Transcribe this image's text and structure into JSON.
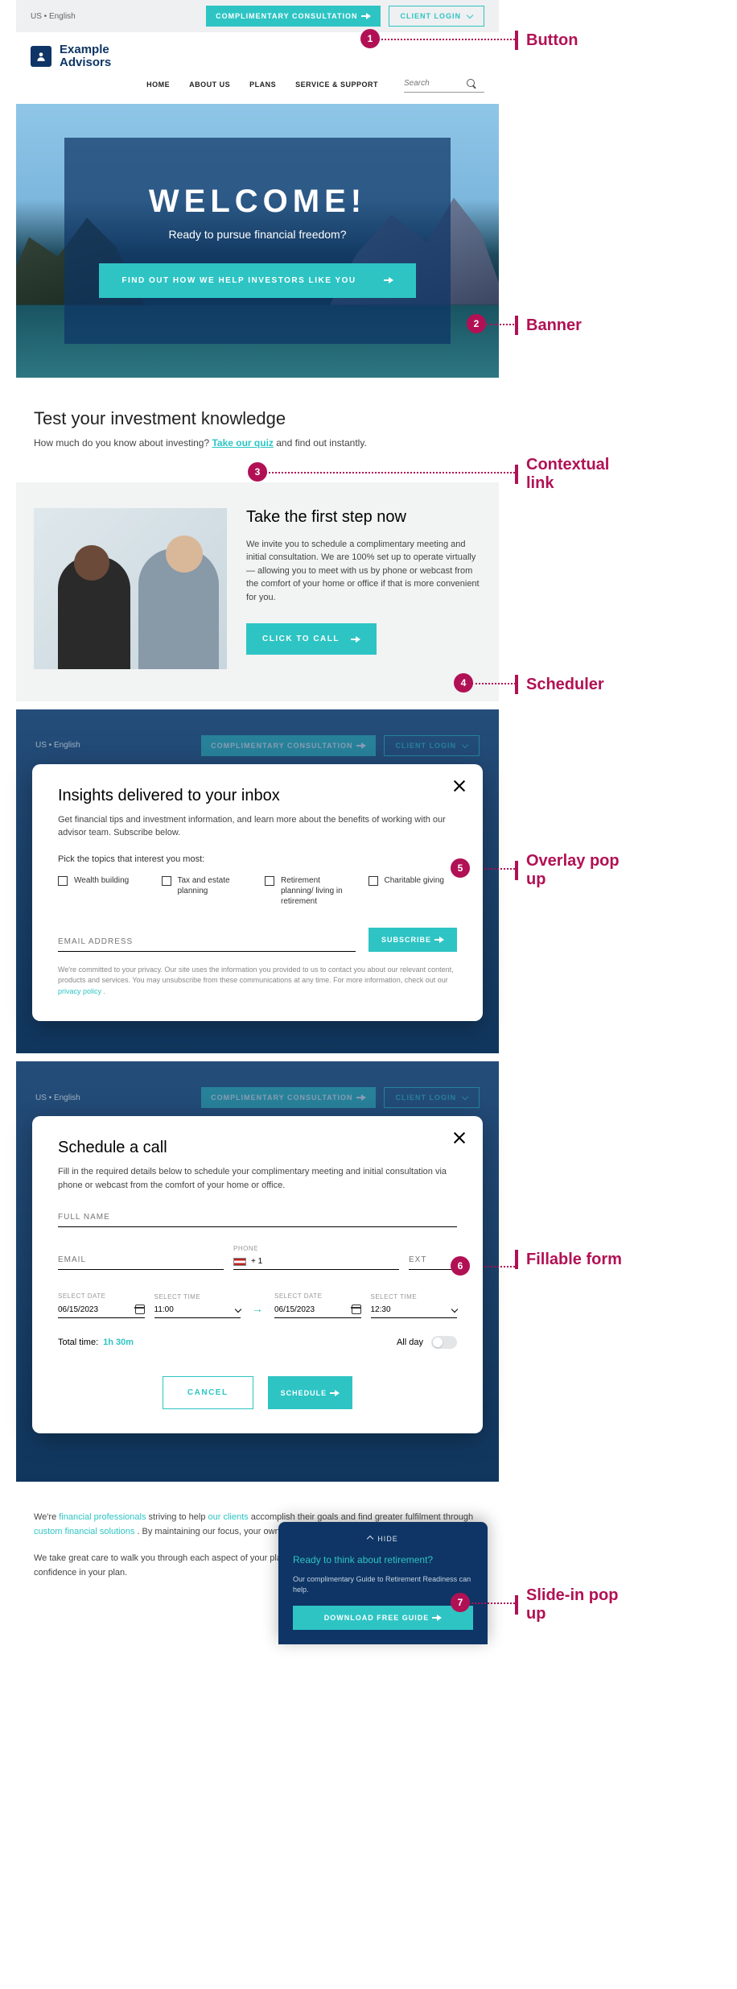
{
  "locale": "US • English",
  "topbar": {
    "consult_btn": "COMPLIMENTARY CONSULTATION",
    "login_btn": "CLIENT LOGIN"
  },
  "brand": {
    "line1": "Example",
    "line2": "Advisors"
  },
  "nav": {
    "home": "HOME",
    "about": "ABOUT US",
    "plans": "PLANS",
    "service": "SERVICE & SUPPORT",
    "search_ph": "Search"
  },
  "banner": {
    "title": "WELCOME!",
    "subtitle": "Ready to pursue financial freedom?",
    "cta": "FIND OUT HOW WE HELP INVESTORS LIKE YOU"
  },
  "quiz": {
    "heading": "Test your investment knowledge",
    "pre": "How much do you know about investing? ",
    "link": "Take our quiz",
    "post": " and find out instantly."
  },
  "firststep": {
    "heading": "Take the first step now",
    "body": "We invite you to schedule a complimentary meeting and initial consultation. We are 100% set up to operate virtually — allowing you to meet with us by phone or webcast from the comfort of your home or office if that is more convenient for you.",
    "cta": "CLICK TO CALL"
  },
  "overlay": {
    "heading": "Insights delivered to your inbox",
    "desc": "Get financial tips and investment information, and learn more about the benefits of working with our advisor team. Subscribe below.",
    "pick": "Pick the topics that interest you most:",
    "topics": [
      "Wealth building",
      "Tax and estate planning",
      "Retirement planning/ living in retirement",
      "Charitable giving"
    ],
    "email_ph": "EMAIL ADDRESS",
    "subscribe": "SUBSCRIBE",
    "privacy_pre": "We're committed to your privacy. Our site uses the information you provided to us to contact you about our relevant content, products and services. You may unsubscribe from these communications at any time. For more information, check out our ",
    "privacy_link": "privacy policy",
    "privacy_post": " ."
  },
  "schedule": {
    "heading": "Schedule a call",
    "desc": "Fill in the required details below to schedule your complimentary meeting and initial consultation via phone or webcast from the comfort of your home or office.",
    "full_name": "FULL NAME",
    "phone_label": "PHONE",
    "phone_prefix": "+ 1",
    "email": "EMAIL",
    "ext": "EXT",
    "sel_date": "SELECT DATE",
    "sel_time": "SELECT TIME",
    "date1": "06/15/2023",
    "time1": "11:00",
    "date2": "06/15/2023",
    "time2": "12:30",
    "total_label": "Total time:",
    "total_val": "1h 30m",
    "allday": "All day",
    "cancel": "CANCEL",
    "submit": "SCHEDULE"
  },
  "bottom": {
    "p1_a": "We're ",
    "p1_l1": "financial professionals",
    "p1_b": " striving to help  ",
    "p1_l2": "our clients",
    "p1_c": " accomplish their goals and find greater fulfilment through ",
    "p1_l3": "custom financial solutions",
    "p1_d": " . By maintaining our focus, your own needs and vision are at the core of what we do.",
    "p2": "We take great care to walk you through each aspect of your plan — establishing a strong relationship and building confidence in your plan."
  },
  "slidein": {
    "hide": "HIDE",
    "q": "Ready to think about retirement?",
    "d": "Our complimentary Guide to Retirement Readiness can help.",
    "cta": "DOWNLOAD FREE GUIDE"
  },
  "labels": {
    "button": "Button",
    "banner": "Banner",
    "contextual": "Contextual link",
    "scheduler": "Scheduler",
    "overlay": "Overlay pop up",
    "form": "Fillable form",
    "slidein": "Slide-in pop up"
  },
  "nums": [
    "1",
    "2",
    "3",
    "4",
    "5",
    "6",
    "7"
  ]
}
